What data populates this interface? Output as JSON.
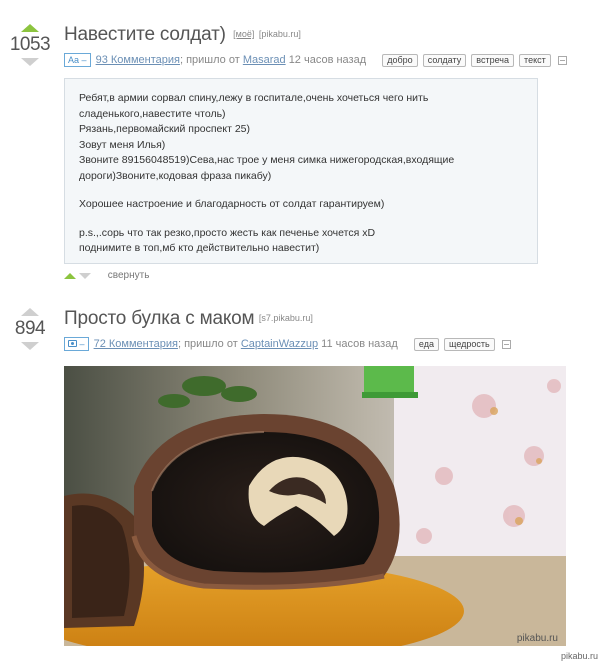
{
  "posts": [
    {
      "rating": "1053",
      "title": "Навестите солдат)",
      "mine_label": "[моё]",
      "domain": "[pikabu.ru]",
      "type_badge": "Aa –",
      "comments": "93 Комментария",
      "sent_prefix": "; пришло от",
      "author": "Masarad",
      "time": "12 часов назад",
      "tags": [
        "добро",
        "солдату",
        "встреча",
        "текст"
      ],
      "text_lines": [
        "Ребят,в армии сорвал спину,лежу в госпитале,очень хочеться чего нить",
        "сладенького,навестите чтоль)",
        "Рязань,первомайский проспект 25)",
        "Зовут меня Илья)",
        "Звоните 89156048519)Сева,нас трое у меня симка нижегородская,входящие",
        "дороги)Звоните,кодовая фраза пикабу)",
        "",
        "Хорошее настроение и благодарность от солдат гарантируем)",
        "",
        "p.s.,.сорь что так резко,просто жесть как печенье хочется xD",
        "поднимите в топ,мб кто действительно навестит)"
      ],
      "collapse_label": "свернуть"
    },
    {
      "rating": "894",
      "title": "Просто булка с маком",
      "domain": "[s7.pikabu.ru]",
      "comments": "72 Комментария",
      "sent_prefix": "; пришло от",
      "author": "CaptainWazzup",
      "time": "11 часов назад",
      "tags": [
        "еда",
        "щедрость"
      ],
      "image_watermark": "pikabu.ru"
    }
  ],
  "footer_watermark": "pikabu.ru",
  "colors": {
    "upvote_active": "#8cc43f",
    "vote_inactive": "#cfcfcf",
    "link": "#6b8fb5",
    "badge_blue": "#4a8fc8",
    "textbox_bg": "#f4f7f9"
  },
  "icons": [
    "upvote-arrow-icon",
    "downvote-arrow-icon",
    "text-post-icon",
    "photo-icon",
    "save-icon"
  ]
}
